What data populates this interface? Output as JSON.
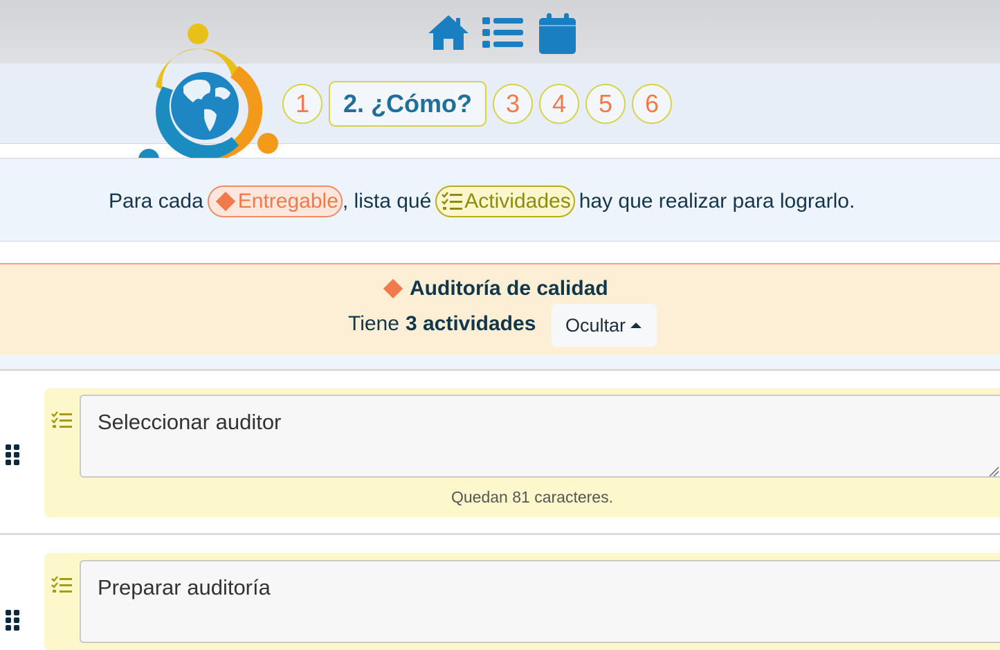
{
  "nav": {
    "icons": [
      "home-icon",
      "list-icon",
      "calendar-icon"
    ]
  },
  "steps": [
    {
      "label": "1"
    },
    {
      "label": "2. ¿Cómo?"
    },
    {
      "label": "3"
    },
    {
      "label": "4"
    },
    {
      "label": "5"
    },
    {
      "label": "6"
    }
  ],
  "instruction": {
    "prefix": "Para cada",
    "entregable": "Entregable",
    "middle": ", lista qué",
    "actividades": "Actividades",
    "suffix": "hay que realizar para lograrlo."
  },
  "deliverable": {
    "title": "Auditoría de calidad",
    "tiene": "Tiene",
    "count": "3 actividades",
    "hide_label": "Ocultar"
  },
  "activities": [
    {
      "text": "Seleccionar auditor",
      "remaining": "Quedan 81 caracteres."
    },
    {
      "text": "Preparar auditoría"
    }
  ],
  "colors": {
    "brand_blue": "#1a7fc0",
    "deliverable_orange": "#f07a4c",
    "activity_olive": "#b9ad1c"
  }
}
